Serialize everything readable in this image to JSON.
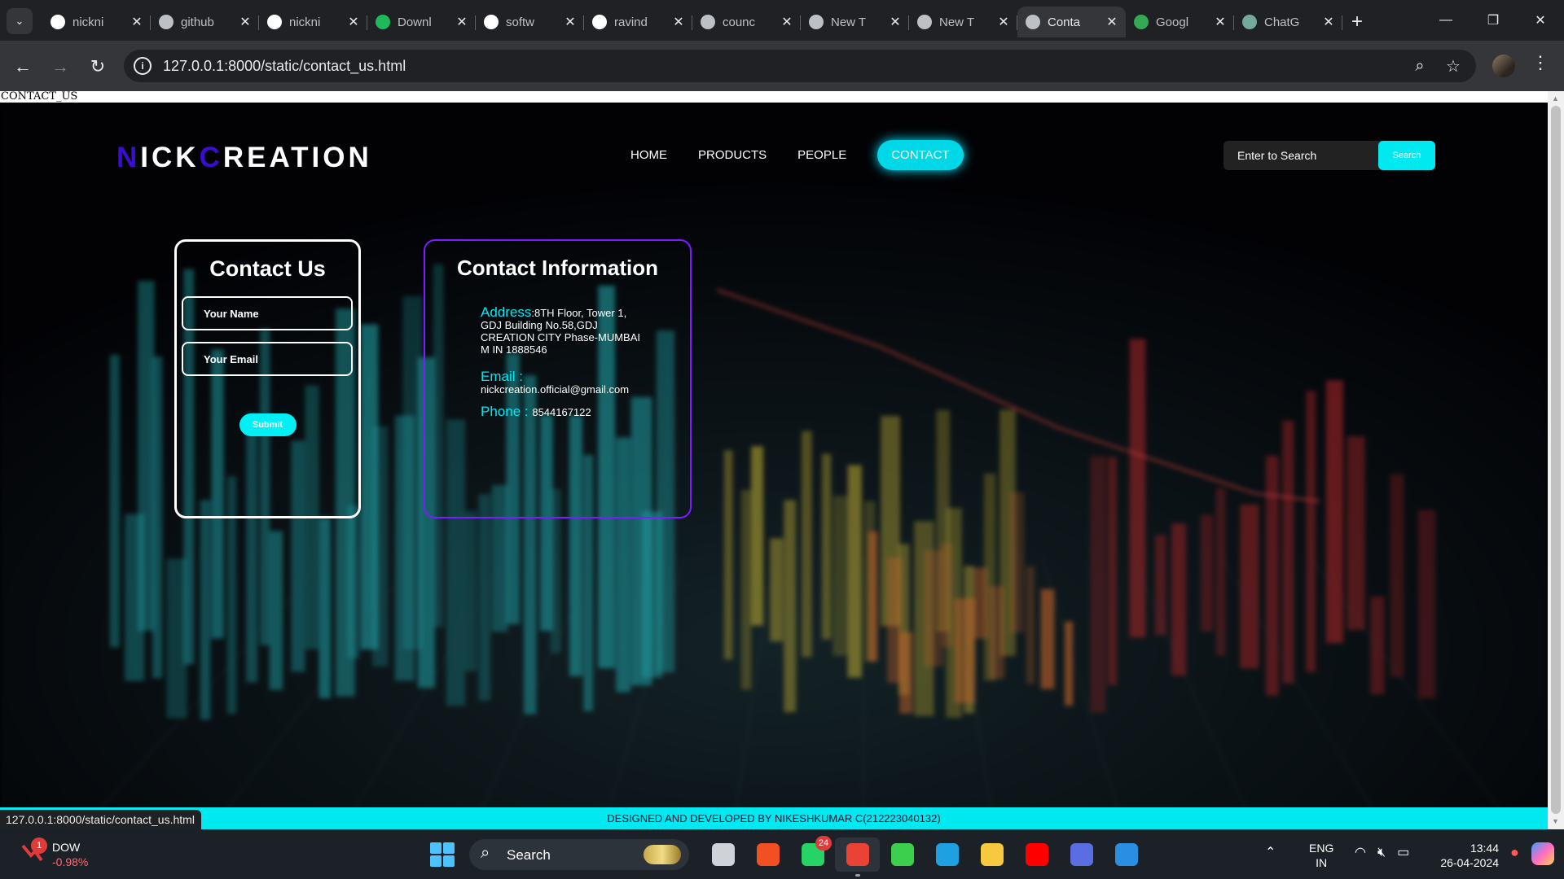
{
  "browser": {
    "tabs": [
      {
        "title": "nickni",
        "favicon": "github-icon",
        "color": "#ffffff"
      },
      {
        "title": "github",
        "favicon": "globe-icon",
        "color": "#bdc1c6"
      },
      {
        "title": "nickni",
        "favicon": "github-icon",
        "color": "#ffffff"
      },
      {
        "title": "Downl",
        "favicon": "w-icon",
        "color": "#1fb85a"
      },
      {
        "title": "softw",
        "favicon": "google-icon",
        "color": "#ffffff"
      },
      {
        "title": "ravind",
        "favicon": "google-icon",
        "color": "#ffffff"
      },
      {
        "title": "counc",
        "favicon": "globe-icon",
        "color": "#bdc1c6"
      },
      {
        "title": "New T",
        "favicon": "chrome-icon",
        "color": "#bdc1c6"
      },
      {
        "title": "New T",
        "favicon": "chrome-icon",
        "color": "#bdc1c6"
      },
      {
        "title": "Conta",
        "favicon": "globe-icon",
        "color": "#bdc1c6",
        "active": true
      },
      {
        "title": "Googl",
        "favicon": "meet-icon",
        "color": "#34a853"
      },
      {
        "title": "ChatG",
        "favicon": "chatgpt-icon",
        "color": "#74aa9c"
      }
    ],
    "url": "127.0.0.1:8000/static/contact_us.html",
    "status_url": "127.0.0.1:8000/static/contact_us.html"
  },
  "page": {
    "heading": "CONTACT_US",
    "logo": {
      "parts": [
        {
          "text": "N",
          "accent": true
        },
        {
          "text": "I",
          "accent": false
        },
        {
          "text": "CK",
          "accent": false
        },
        {
          "text": "C",
          "accent": true
        },
        {
          "text": "REATION",
          "accent": false
        }
      ]
    },
    "nav": {
      "home": "HOME",
      "products": "PRODUCTS",
      "people": "PEOPLE",
      "contact": "CONTACT"
    },
    "search": {
      "placeholder": "Enter to Search",
      "button": "Search"
    },
    "contact_form": {
      "title": "Contact Us",
      "name_placeholder": "Your Name",
      "email_placeholder": "Your Email",
      "submit": "Submit"
    },
    "contact_info": {
      "title": "Contact Information",
      "address_label": "Address",
      "address_value": ":8TH Floor, Tower 1, GDJ Building No.58,GDJ CREATION CITY Phase-MUMBAI M IN 1888546",
      "email_label": "Email",
      "email_sep": " :",
      "email_value": "nickcreation.official@gmail.com",
      "phone_label": "Phone",
      "phone_sep": " : ",
      "phone_value": "8544167122"
    },
    "footer": "DESIGNED AND DEVELOPED BY NIKESHKUMAR C(212223040132)",
    "colors": {
      "accent_cyan": "#00e8f0",
      "logo_accent": "#3b0cd1",
      "info_border": "#7c1cff"
    }
  },
  "taskbar": {
    "widget": {
      "name": "DOW",
      "value": "-0.98%",
      "badge": "1"
    },
    "search_label": "Search",
    "apps": [
      {
        "name": "task-view-icon",
        "color": "#cfd3d8"
      },
      {
        "name": "microsoft-store-icon",
        "color": "#f25022"
      },
      {
        "name": "whatsapp-icon",
        "color": "#25d366",
        "badge": "24"
      },
      {
        "name": "chrome-icon",
        "color": "#ea4335",
        "active": true
      },
      {
        "name": "refresh-app-icon",
        "color": "#3ccf4e"
      },
      {
        "name": "edge-icon",
        "color": "#1fa0e0"
      },
      {
        "name": "file-explorer-icon",
        "color": "#f8c93e"
      },
      {
        "name": "youtube-icon",
        "color": "#ff0000"
      },
      {
        "name": "arc-app-icon",
        "color": "#5b6ee1"
      },
      {
        "name": "vscode-icon",
        "color": "#2a8fe0"
      }
    ],
    "lang_top": "ENG",
    "lang_bottom": "IN",
    "time": "13:44",
    "date": "26-04-2024"
  }
}
